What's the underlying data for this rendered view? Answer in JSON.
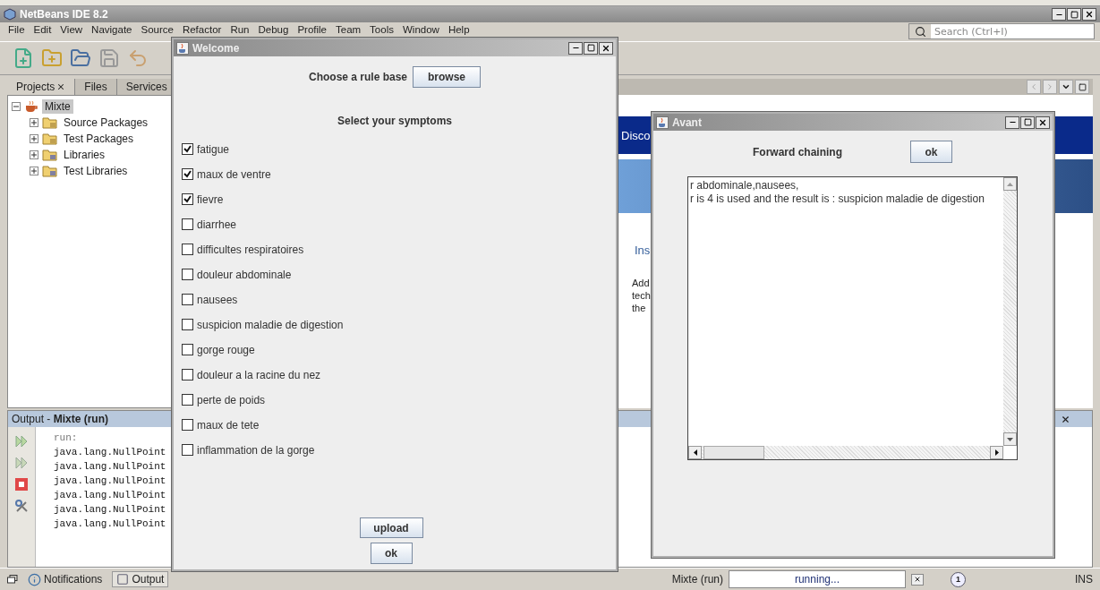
{
  "ide": {
    "title": "NetBeans IDE 8.2",
    "menu": [
      "File",
      "Edit",
      "View",
      "Navigate",
      "Source",
      "Refactor",
      "Run",
      "Debug",
      "Profile",
      "Team",
      "Tools",
      "Window",
      "Help"
    ],
    "search": {
      "placeholder": "Search (Ctrl+I)"
    }
  },
  "projects": {
    "tabs": [
      {
        "label": "Projects",
        "selected": true
      },
      {
        "label": "Files",
        "selected": false
      },
      {
        "label": "Services",
        "selected": false
      }
    ],
    "tree": [
      {
        "label": "Mixte",
        "kind": "project",
        "expanded": true,
        "selected": true,
        "children": [
          {
            "label": "Source Packages",
            "kind": "package",
            "expanded": false,
            "selected": false
          },
          {
            "label": "Test Packages",
            "kind": "package",
            "expanded": false,
            "selected": false
          },
          {
            "label": "Libraries",
            "kind": "library",
            "expanded": false,
            "selected": false
          },
          {
            "label": "Test Libraries",
            "kind": "library",
            "expanded": false,
            "selected": false
          }
        ]
      }
    ]
  },
  "editor": {
    "banner_text": "Disco",
    "link_text": "Ins",
    "paragraph": [
      "Add",
      "tech",
      "the"
    ]
  },
  "output": {
    "title": "Output - **Mixte (run)**",
    "lines": [
      {
        "text": "run:",
        "kind": "info"
      },
      {
        "text": "java.lang.NullPoint",
        "kind": "error"
      },
      {
        "text": "java.lang.NullPoint",
        "kind": "error"
      },
      {
        "text": "java.lang.NullPoint",
        "kind": "error"
      },
      {
        "text": "java.lang.NullPoint",
        "kind": "error"
      },
      {
        "text": "java.lang.NullPoint",
        "kind": "error"
      },
      {
        "text": "java.lang.NullPoint",
        "kind": "error"
      }
    ]
  },
  "status_bar": {
    "tabs": [
      {
        "label": "Notifications",
        "kind": "notifications",
        "selected": false
      },
      {
        "label": "Output",
        "kind": "output",
        "selected": true
      }
    ],
    "task": "Mixte (run)",
    "progress": "running...",
    "notifications": "1",
    "mode": "INS"
  },
  "welcome": {
    "title": "Welcome",
    "rule_base_label": "Choose a rule base",
    "browse_button": "browse",
    "symptoms_title": "Select your symptoms",
    "symptoms": [
      {
        "label": "fatigue",
        "checked": true
      },
      {
        "label": "maux de ventre",
        "checked": true
      },
      {
        "label": "fievre",
        "checked": true
      },
      {
        "label": "diarrhee",
        "checked": false
      },
      {
        "label": "difficultes respiratoires",
        "checked": false
      },
      {
        "label": "douleur abdominale",
        "checked": false
      },
      {
        "label": "nausees",
        "checked": false
      },
      {
        "label": "suspicion maladie de digestion",
        "checked": false
      },
      {
        "label": "gorge rouge",
        "checked": false
      },
      {
        "label": "douleur a la racine du nez",
        "checked": false
      },
      {
        "label": "perte de poids",
        "checked": false
      },
      {
        "label": "maux de tete",
        "checked": false
      },
      {
        "label": "inflammation de la gorge",
        "checked": false
      }
    ],
    "buttons": [
      "upload",
      "ok"
    ]
  },
  "avant": {
    "title": "Avant",
    "label": "Forward chaining",
    "ok_button": "ok",
    "lines": [
      "r abdominale,nausees,",
      "r is 4 is used and the result is : suspicion maladie de digestion"
    ]
  }
}
